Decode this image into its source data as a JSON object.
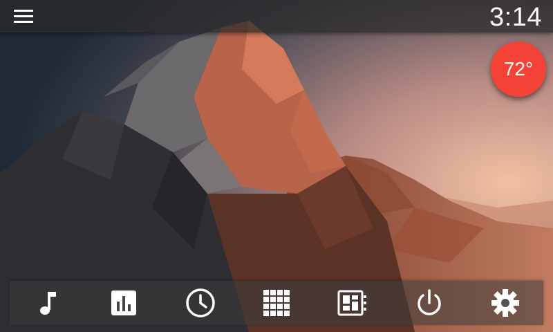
{
  "topbar": {
    "menu_icon": "menu-icon",
    "clock": "3:14"
  },
  "weather": {
    "temperature": "72°",
    "color": "#f44336"
  },
  "dock": {
    "items": [
      {
        "icon": "music-note-icon"
      },
      {
        "icon": "bar-chart-icon"
      },
      {
        "icon": "clock-icon"
      },
      {
        "icon": "grid-apps-icon"
      },
      {
        "icon": "dashboard-icon"
      },
      {
        "icon": "power-icon"
      },
      {
        "icon": "settings-gear-icon"
      }
    ]
  },
  "colors": {
    "accent": "#f44336",
    "icon": "#ffffff"
  }
}
